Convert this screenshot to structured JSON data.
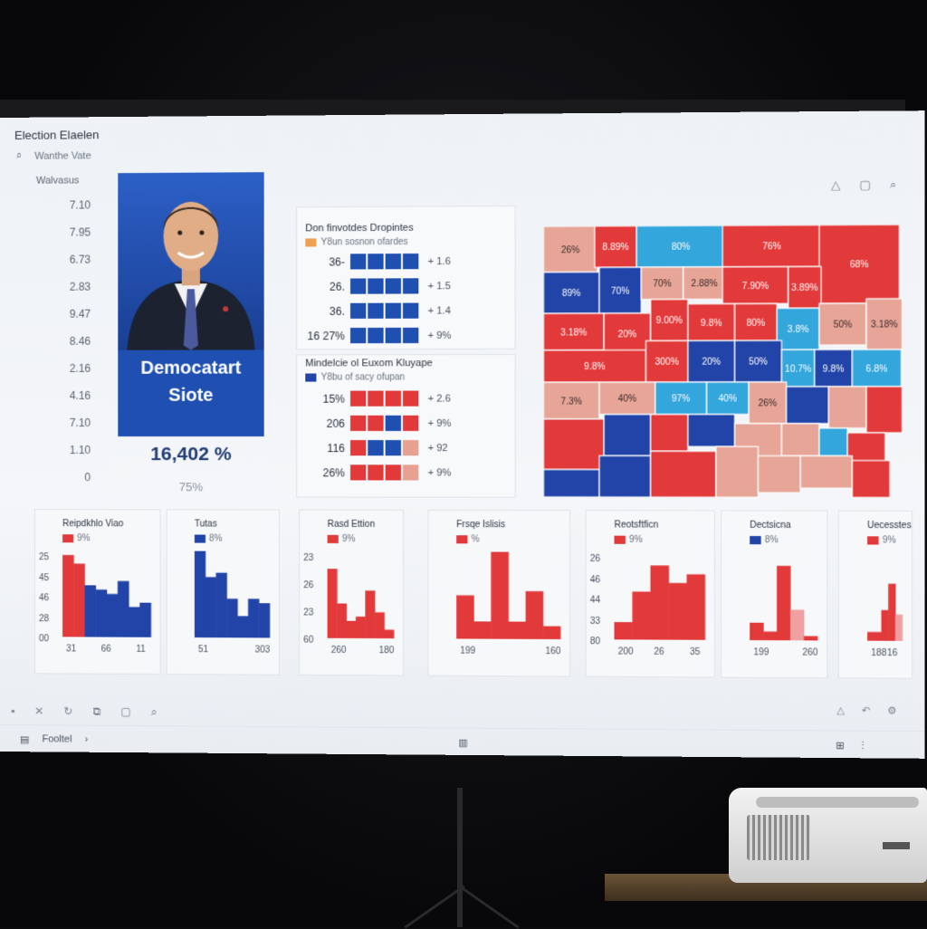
{
  "app": {
    "title": "Election Elaelen",
    "search_label": "Wanthe Vate"
  },
  "y_axis": {
    "title": "Walvasus",
    "values": [
      "7.10",
      "7.95",
      "6.73",
      "2.83",
      "9.47",
      "8.46",
      "2.16",
      "4.16",
      "7.10",
      "1.10",
      "0"
    ]
  },
  "candidate": {
    "label_line1": "Democatart",
    "label_line2": "Siote",
    "value": "16,402 %",
    "sub": "75%"
  },
  "grid1": {
    "title": "Don finvotdes Dropintes",
    "legend": "Y8un sosnon ofardes",
    "rows": [
      {
        "label": "36-",
        "cells": [
          "b",
          "b",
          "b",
          "b"
        ],
        "delta": "+ 1.6"
      },
      {
        "label": "26.",
        "cells": [
          "b",
          "b",
          "b",
          "b"
        ],
        "delta": "+ 1.5"
      },
      {
        "label": "36.",
        "cells": [
          "b",
          "b",
          "b",
          "b"
        ],
        "delta": "+ 1.4"
      },
      {
        "label": "16 27%",
        "cells": [
          "b",
          "b",
          "b",
          "b"
        ],
        "delta": "+ 9%"
      }
    ]
  },
  "grid2": {
    "title": "Mindelcie ol Euxom Kluyape",
    "legend": "Y8bu of sacy ofupan",
    "rows": [
      {
        "label": "15%",
        "cells": [
          "r",
          "r",
          "r",
          "r"
        ],
        "delta": "+ 2.6"
      },
      {
        "label": "206",
        "cells": [
          "r",
          "r",
          "b",
          "r"
        ],
        "delta": "+ 9%"
      },
      {
        "label": "116",
        "cells": [
          "r",
          "b",
          "b",
          "p"
        ],
        "delta": "+ 92"
      },
      {
        "label": "26%",
        "cells": [
          "r",
          "r",
          "r",
          "p"
        ],
        "delta": "+ 9%"
      }
    ]
  },
  "map": {
    "labels": [
      "26%",
      "8.89%",
      "80%",
      "76%",
      "68%",
      "89%",
      "70%",
      "70%",
      "2.88%",
      "7.90%",
      "3.89%",
      "3.18%",
      "20%",
      "9.00%",
      "9.8%",
      "80%",
      "3.8%",
      "50%",
      "3.18%",
      "9.8%",
      "300%",
      "20%",
      "50%",
      "10.7%",
      "9.8%",
      "6.8%",
      "7.3%",
      "40%",
      "97%",
      "40%",
      "26%"
    ],
    "colors": {
      "red": "#e23a3a",
      "blue": "#2244a8",
      "light_blue": "#33a6dc",
      "pink": "#e6a597"
    }
  },
  "charts": [
    {
      "title": "Reipdkhlo Viao",
      "legend": "9%",
      "legend_color": "#e23a3a",
      "ticks_y": [
        "25",
        "45",
        "46",
        "28",
        "00"
      ],
      "ticks_x": [
        "31",
        "66",
        "11"
      ]
    },
    {
      "title": "Tutas",
      "legend": "8%",
      "legend_color": "#2244a8",
      "ticks_y": [],
      "ticks_x": [
        "51",
        "303"
      ]
    },
    {
      "title": "Rasd Ettion",
      "legend": "9%",
      "legend_color": "#e23a3a",
      "ticks_y": [
        "23",
        "26",
        "23",
        "60"
      ],
      "ticks_x": [
        "260",
        "180"
      ]
    },
    {
      "title": "Frsqe Islisis",
      "legend": "%",
      "legend_color": "#e23a3a",
      "ticks_y": [],
      "ticks_x": [
        "199",
        "160"
      ]
    },
    {
      "title": "Reotsftficn",
      "legend": "9%",
      "legend_color": "#e23a3a",
      "ticks_y": [
        "26",
        "46",
        "44",
        "33",
        "80"
      ],
      "ticks_x": [
        "200",
        "26",
        "35"
      ]
    },
    {
      "title": "Dectsicna",
      "legend": "8%",
      "legend_color": "#2244a8",
      "ticks_y": [],
      "ticks_x": [
        "199",
        "260"
      ]
    },
    {
      "title": "Uecesstes",
      "legend": "9%",
      "legend_color": "#e23a3a",
      "ticks_y": [],
      "ticks_x": [
        "188",
        "16"
      ]
    }
  ],
  "footer": {
    "label": "Fooltel"
  }
}
